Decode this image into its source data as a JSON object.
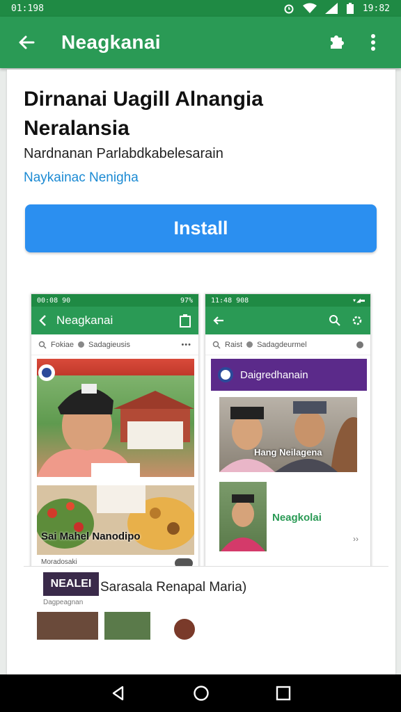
{
  "status_bar": {
    "left_text": "01:198",
    "time": "19:82"
  },
  "app_bar": {
    "title": "Neagkanai",
    "icons": [
      "back-arrow-icon",
      "puzzle-icon",
      "more-vert-icon"
    ]
  },
  "listing": {
    "title": "Dirnanai Uagill Alnangia Neralansia",
    "developer": "Nardnanan Parlabdkabelesarain",
    "category": "Naykainac Nenigha",
    "install_label": "Install"
  },
  "screenshot1": {
    "status_left": "00:08 90",
    "status_right": "97%",
    "title": "Neagkanai",
    "search_text": "Fokiae",
    "search_text2": "Sadagieusis",
    "caption": "Sai Mahel Nanodipo",
    "small_caption": "Moradosaki"
  },
  "screenshot2": {
    "status_left": "11:48 908",
    "search_text": "Raist",
    "search_text2": "Sadagdeurmel",
    "banner_label": "Daigredhanain",
    "photo_caption": "Hang Neilagena",
    "item_label": "Neagkolai"
  },
  "bottom_strip": {
    "thumb_label": "NEALEI",
    "label": "Sarasala Renapal Maria)",
    "sub_label": "Dagpeagnan"
  },
  "colors": {
    "primary_green": "#2a9a55",
    "dark_green": "#1f8a44",
    "install_blue": "#2b8ff0",
    "category_blue": "#1b8ad3"
  }
}
